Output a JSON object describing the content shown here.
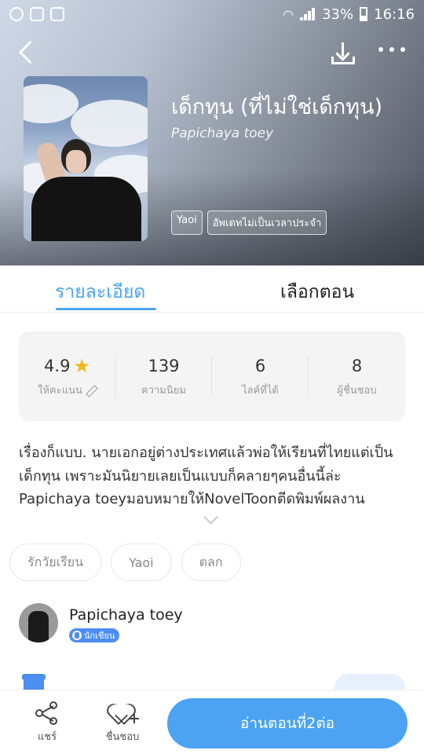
{
  "status_bar": {
    "battery": "33%",
    "time": "16:16",
    "icons": [
      "messenger-icon",
      "facebook-icon",
      "recycle-icon",
      "wifi-icon",
      "signal-icon",
      "battery-icon"
    ]
  },
  "header": {
    "title": "เด็กทุน (ที่ไม่ใช่เด็กทุน)",
    "author": "Papichaya toey",
    "tags": [
      "Yaoi",
      "อัพเดทไม่เป็นเวลาประจำ"
    ],
    "icons": [
      "back-icon",
      "download-icon",
      "more-icon"
    ]
  },
  "tabs": {
    "detail": "รายละเอียด",
    "episodes": "เลือกตอน",
    "active": "detail"
  },
  "stats": [
    {
      "value": "4.9",
      "label": "ให้คะแนน"
    },
    {
      "value": "139",
      "label": "ความนิยม"
    },
    {
      "value": "6",
      "label": "ไลค์ที่ได้"
    },
    {
      "value": "8",
      "label": "ผู้ชื่นชอบ"
    }
  ],
  "description": "เรื่องก็แบบ. นายเอกอยู่ต่างประเทศแล้วพ่อให้เรียนที่ไทยแต่เป็นเด็กทุน เพราะมันนิยายเลยเป็นแบบก็คลายๆคนอื่นนี้ล่ะ Papichaya toeyมอบหมายให้NovelToonตีดพิมพ์ผลงาน",
  "chips": [
    "รักวัยเรียน",
    "Yaoi",
    "ตลก"
  ],
  "author_row": {
    "name": "Papichaya toey",
    "badge": "นักเขียน"
  },
  "bottom_bar": {
    "share": "แชร์",
    "favorite": "ชื่นชอบ",
    "read": "อ่านตอนที่2ต่อ"
  },
  "colors": {
    "accent": "#4ba3f2",
    "star": "#f5b71c"
  }
}
